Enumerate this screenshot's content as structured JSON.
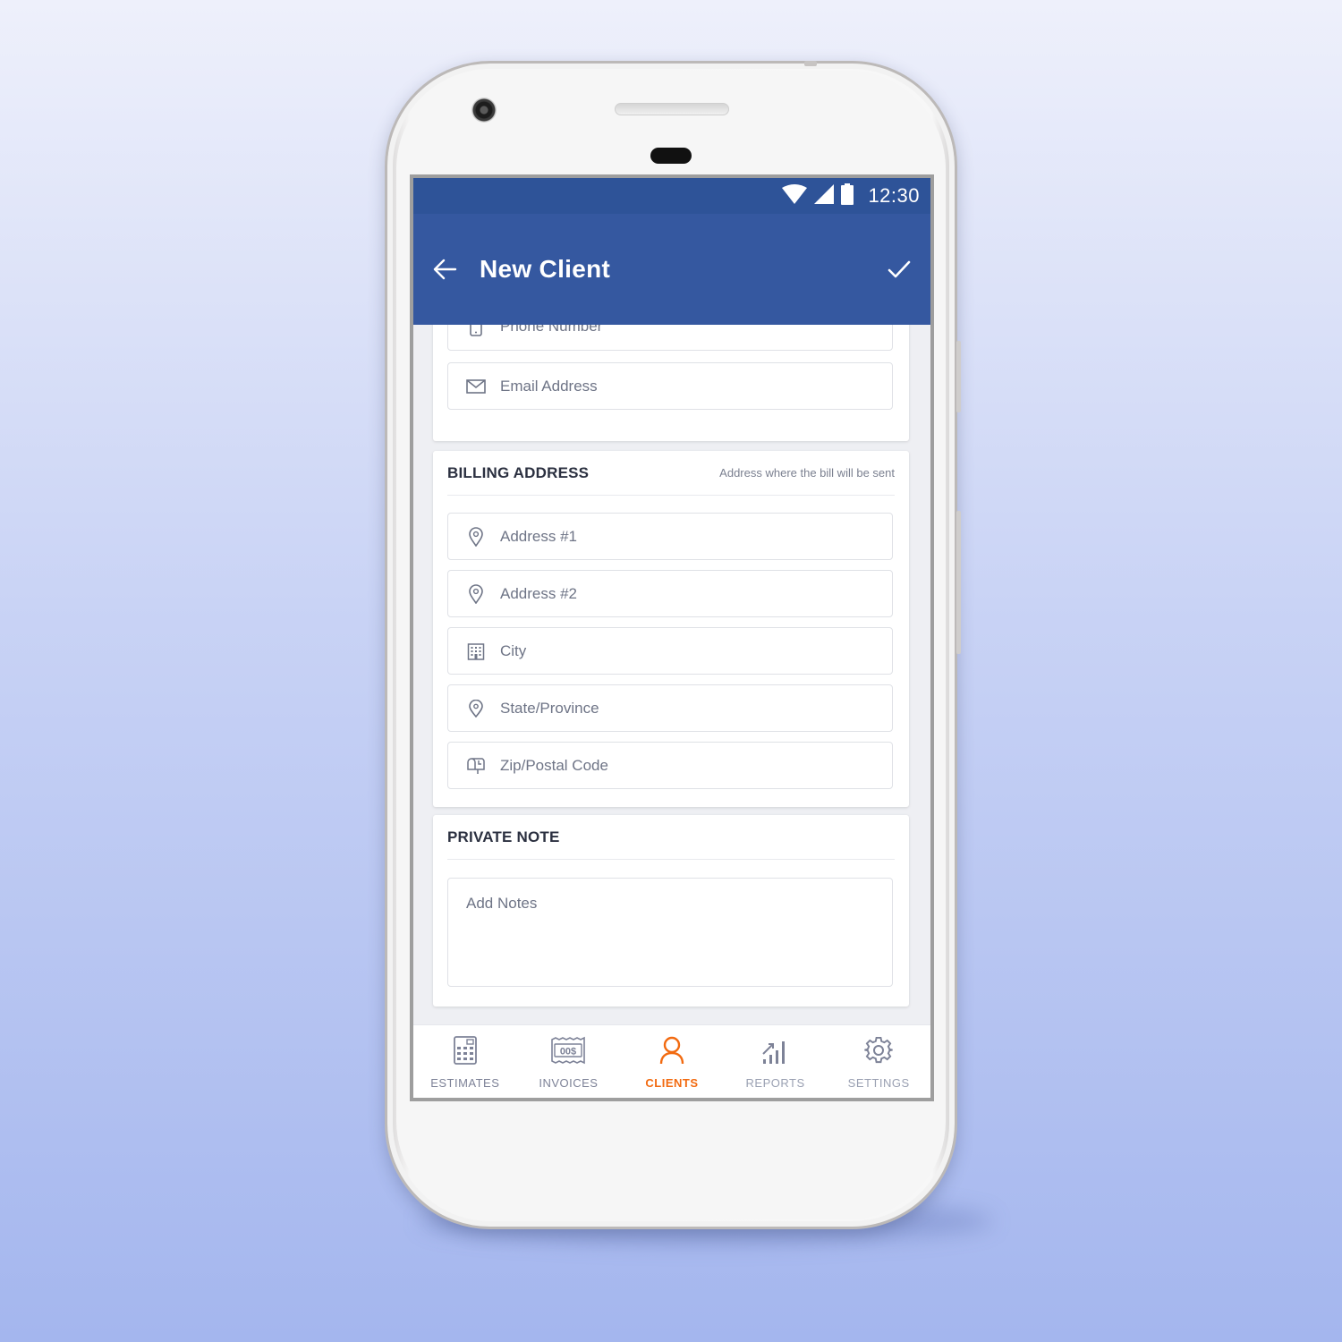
{
  "status_bar": {
    "time": "12:30"
  },
  "app_bar": {
    "title": "New Client"
  },
  "contact_fields": [
    {
      "label": "Phone Number",
      "icon": "phone-icon"
    },
    {
      "label": "Email Address",
      "icon": "mail-icon"
    }
  ],
  "billing": {
    "title": "BILLING ADDRESS",
    "subtitle": "Address where the bill will be sent",
    "fields": [
      {
        "label": "Address #1",
        "icon": "location-pin-icon"
      },
      {
        "label": "Address #2",
        "icon": "location-pin-icon"
      },
      {
        "label": "City",
        "icon": "building-icon"
      },
      {
        "label": "State/Province",
        "icon": "location-pin-icon"
      },
      {
        "label": "Zip/Postal Code",
        "icon": "mailbox-icon"
      }
    ]
  },
  "private_note": {
    "title": "PRIVATE NOTE",
    "placeholder": "Add Notes"
  },
  "nav": [
    {
      "label": "ESTIMATES",
      "icon": "calculator-icon",
      "active": false
    },
    {
      "label": "INVOICES",
      "icon": "invoice-icon",
      "active": false
    },
    {
      "label": "CLIENTS",
      "icon": "person-icon",
      "active": true
    },
    {
      "label": "REPORTS",
      "icon": "bar-chart-icon",
      "active": false
    },
    {
      "label": "SETTINGS",
      "icon": "gear-icon",
      "active": false
    }
  ],
  "invoice_icon_text": "00$",
  "colors": {
    "primary": "#3558a0",
    "status_bar": "#2e5398",
    "accent": "#f26a10",
    "nav_inactive": "#7d8297",
    "icon_gray": "#6e7486"
  }
}
